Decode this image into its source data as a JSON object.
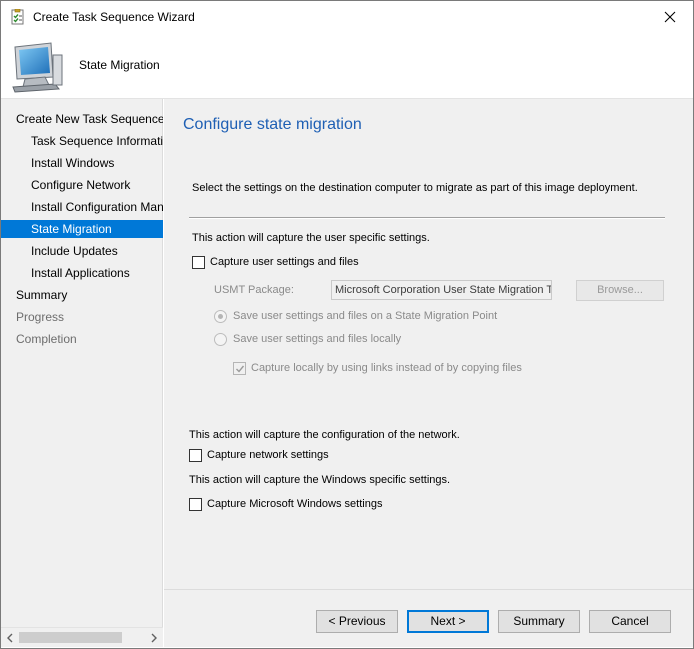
{
  "window": {
    "title": "Create Task Sequence Wizard",
    "close_icon": "close-icon"
  },
  "header": {
    "title": "State Migration",
    "icon": "computer-monitor-icon"
  },
  "sidebar": {
    "items": [
      {
        "label": "Create New Task Sequence",
        "level": 0,
        "state": "normal"
      },
      {
        "label": "Task Sequence Information",
        "level": 1,
        "state": "normal"
      },
      {
        "label": "Install Windows",
        "level": 1,
        "state": "normal"
      },
      {
        "label": "Configure Network",
        "level": 1,
        "state": "normal"
      },
      {
        "label": "Install Configuration Manager",
        "level": 1,
        "state": "normal"
      },
      {
        "label": "State Migration",
        "level": 1,
        "state": "selected"
      },
      {
        "label": "Include Updates",
        "level": 1,
        "state": "normal"
      },
      {
        "label": "Install Applications",
        "level": 1,
        "state": "normal"
      },
      {
        "label": "Summary",
        "level": 0,
        "state": "normal"
      },
      {
        "label": "Progress",
        "level": 0,
        "state": "disabled"
      },
      {
        "label": "Completion",
        "level": 0,
        "state": "disabled"
      }
    ]
  },
  "main": {
    "page_title": "Configure state migration",
    "instruction": "Select the settings on the destination computer to migrate as part of this image deployment.",
    "user_section": {
      "description": "This action will capture the user specific settings.",
      "capture_label": "Capture user settings and files",
      "capture_checked": false,
      "usmt_label": "USMT Package:",
      "usmt_value": "Microsoft Corporation User State Migration Tool",
      "browse_label": "Browse...",
      "radio_smp_label": "Save user settings and files on a State Migration Point",
      "radio_smp_selected": true,
      "radio_local_label": "Save user settings and files locally",
      "radio_local_selected": false,
      "links_label": "Capture locally by using links instead of by copying files",
      "links_checked": true
    },
    "network_section": {
      "description": "This action will capture the configuration of the network.",
      "capture_label": "Capture network settings",
      "capture_checked": false
    },
    "windows_section": {
      "description": "This action will capture the Windows specific settings.",
      "capture_label": "Capture Microsoft Windows settings",
      "capture_checked": false
    }
  },
  "buttons": {
    "previous": "< Previous",
    "next": "Next >",
    "summary": "Summary",
    "cancel": "Cancel"
  },
  "colors": {
    "accent": "#0078d7",
    "page_title": "#1e5fb4",
    "sidebar_bg": "#f0f0f0"
  }
}
